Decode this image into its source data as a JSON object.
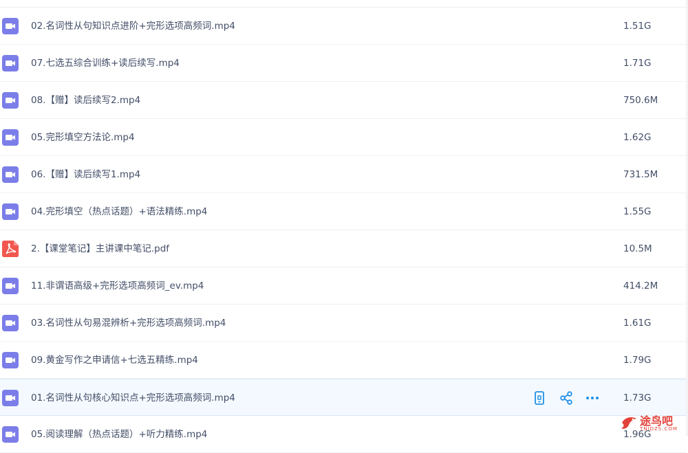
{
  "files": [
    {
      "name": "02.名词性从句知识点进阶+完形选项高频词.mp4",
      "size": "1.51G",
      "type": "video",
      "icon": "video-file-icon"
    },
    {
      "name": "07.七选五综合训练+读后续写.mp4",
      "size": "1.71G",
      "type": "video",
      "icon": "video-file-icon"
    },
    {
      "name": "08.【赠】读后续写2.mp4",
      "size": "750.6M",
      "type": "video",
      "icon": "video-file-icon"
    },
    {
      "name": "05.完形填空方法论.mp4",
      "size": "1.62G",
      "type": "video",
      "icon": "video-file-icon"
    },
    {
      "name": "06.【赠】读后续写1.mp4",
      "size": "731.5M",
      "type": "video",
      "icon": "video-file-icon"
    },
    {
      "name": "04.完形填空（热点话题）+语法精练.mp4",
      "size": "1.55G",
      "type": "video",
      "icon": "video-file-icon"
    },
    {
      "name": "2.【课堂笔记】主讲课中笔记.pdf",
      "size": "10.5M",
      "type": "pdf",
      "icon": "pdf-file-icon"
    },
    {
      "name": "11.非谓语高级+完形选项高频词_ev.mp4",
      "size": "414.2M",
      "type": "video",
      "icon": "video-file-icon"
    },
    {
      "name": "03.名词性从句易混辨析+完形选项高频词.mp4",
      "size": "1.61G",
      "type": "video",
      "icon": "video-file-icon"
    },
    {
      "name": "09.黄金写作之申请信+七选五精练.mp4",
      "size": "1.79G",
      "type": "video",
      "icon": "video-file-icon"
    },
    {
      "name": "01.名词性从句核心知识点+完形选项高频词.mp4",
      "size": "1.73G",
      "type": "video",
      "icon": "video-file-icon",
      "highlighted": true
    },
    {
      "name": "05.阅读理解（热点话题）+听力精练.mp4",
      "size": "1.96G",
      "type": "video",
      "icon": "video-file-icon"
    }
  ],
  "row_actions": [
    {
      "icon": "phone-icon",
      "name": "send-to-phone-button"
    },
    {
      "icon": "share-icon",
      "name": "share-button"
    },
    {
      "icon": "more-icon",
      "name": "more-button"
    }
  ],
  "watermark": {
    "text": "途鸟吧",
    "sub": "TNIDZS.COM"
  },
  "colors": {
    "video": "#7b7ee8",
    "pdf": "#f2574f",
    "accent": "#1e90e6",
    "text": "#424e67",
    "highlight_bg": "#f4f9ff"
  }
}
